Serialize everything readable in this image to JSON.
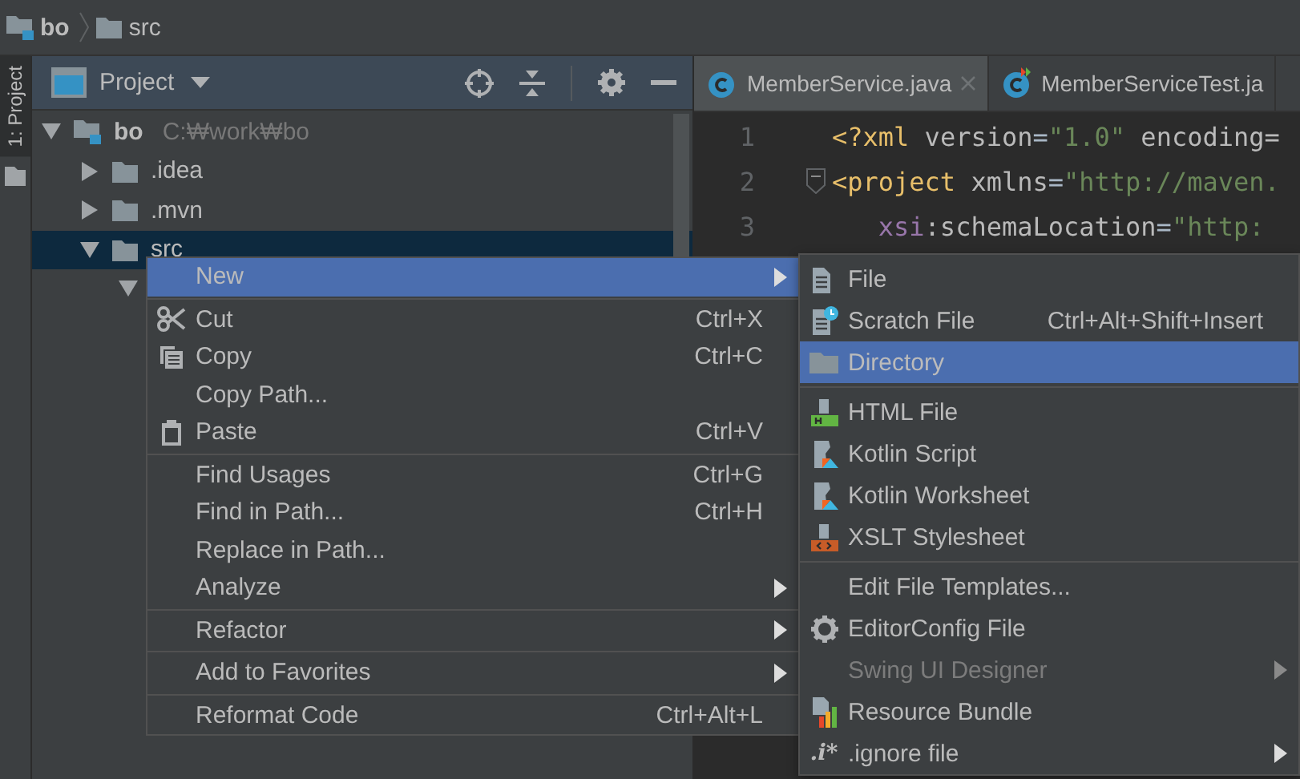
{
  "breadcrumb": [
    {
      "label": "bo",
      "kind": "module"
    },
    {
      "label": "src",
      "kind": "folder"
    }
  ],
  "tool_strip": {
    "tab_label": "1: Project"
  },
  "project_panel": {
    "title": "Project",
    "tree": [
      {
        "label": "bo",
        "path": "C:₩work₩bo",
        "kind": "module",
        "expanded": true,
        "selected": false,
        "children": [
          {
            "label": ".idea",
            "kind": "folder",
            "expanded": false,
            "selected": false
          },
          {
            "label": ".mvn",
            "kind": "folder",
            "expanded": false,
            "selected": false
          },
          {
            "label": "src",
            "kind": "folder",
            "expanded": true,
            "selected": true,
            "children": [
              {
                "expanded": true,
                "selected": false
              }
            ]
          }
        ]
      }
    ]
  },
  "editor": {
    "tabs": [
      {
        "label": "MemberService.java",
        "kind": "class",
        "selected": true
      },
      {
        "label": "MemberServiceTest.ja",
        "kind": "test-class",
        "selected": false
      }
    ],
    "lines": [
      {
        "number": "1",
        "fold": false,
        "tokens": [
          {
            "text": "<?xml",
            "kind": "tag"
          },
          {
            "text": " version",
            "kind": "attr"
          },
          {
            "text": "=",
            "kind": "plain"
          },
          {
            "text": "\"1.0\"",
            "kind": "value"
          },
          {
            "text": " encoding=",
            "kind": "attr"
          }
        ]
      },
      {
        "number": "2",
        "fold": true,
        "tokens": [
          {
            "text": "<project",
            "kind": "tag"
          },
          {
            "text": " xmlns",
            "kind": "attr"
          },
          {
            "text": "=",
            "kind": "plain"
          },
          {
            "text": "\"http://maven.",
            "kind": "value"
          }
        ]
      },
      {
        "number": "3",
        "fold": false,
        "tokens": [
          {
            "text": "   xsi",
            "kind": "ns"
          },
          {
            "text": ":schemaLocation",
            "kind": "attr"
          },
          {
            "text": "=",
            "kind": "plain"
          },
          {
            "text": "\"http:",
            "kind": "value"
          }
        ]
      }
    ]
  },
  "context_menu": {
    "groups": [
      [
        {
          "label": "New",
          "kind": "plain",
          "submenu": true,
          "selected": true
        }
      ],
      [
        {
          "label": "Cut",
          "shortcut": "Ctrl+X",
          "kind": "scissors",
          "submenu": false,
          "selected": false
        },
        {
          "label": "Copy",
          "shortcut": "Ctrl+C",
          "kind": "copy",
          "submenu": false,
          "selected": false
        },
        {
          "label": "Copy Path...",
          "kind": "plain",
          "submenu": false,
          "selected": false
        },
        {
          "label": "Paste",
          "shortcut": "Ctrl+V",
          "kind": "paste",
          "submenu": false,
          "selected": false
        }
      ],
      [
        {
          "label": "Find Usages",
          "shortcut": "Ctrl+G",
          "kind": "plain",
          "submenu": false,
          "selected": false
        },
        {
          "label": "Find in Path...",
          "shortcut": "Ctrl+H",
          "kind": "plain",
          "submenu": false,
          "selected": false
        },
        {
          "label": "Replace in Path...",
          "kind": "plain",
          "submenu": false,
          "selected": false
        },
        {
          "label": "Analyze",
          "kind": "plain",
          "submenu": true,
          "selected": false
        }
      ],
      [
        {
          "label": "Refactor",
          "kind": "plain",
          "submenu": true,
          "selected": false
        }
      ],
      [
        {
          "label": "Add to Favorites",
          "kind": "plain",
          "submenu": true,
          "selected": false
        }
      ],
      [
        {
          "label": "Reformat Code",
          "shortcut": "Ctrl+Alt+L",
          "kind": "plain",
          "submenu": false,
          "selected": false
        }
      ]
    ]
  },
  "submenu": {
    "groups": [
      [
        {
          "label": "File",
          "kind": "file",
          "submenu": false,
          "disabled": false,
          "selected": false
        },
        {
          "label": "Scratch File",
          "shortcut": "Ctrl+Alt+Shift+Insert",
          "kind": "scratch",
          "submenu": false,
          "disabled": false,
          "selected": false
        },
        {
          "label": "Directory",
          "kind": "folder",
          "submenu": false,
          "disabled": false,
          "selected": true
        }
      ],
      [
        {
          "label": "HTML File",
          "kind": "html",
          "submenu": false,
          "disabled": false,
          "selected": false
        },
        {
          "label": "Kotlin Script",
          "kind": "kotlin",
          "submenu": false,
          "disabled": false,
          "selected": false
        },
        {
          "label": "Kotlin Worksheet",
          "kind": "kotlin",
          "submenu": false,
          "disabled": false,
          "selected": false
        },
        {
          "label": "XSLT Stylesheet",
          "kind": "xslt",
          "submenu": false,
          "disabled": false,
          "selected": false
        }
      ],
      [
        {
          "label": "Edit File Templates...",
          "kind": "plain",
          "submenu": false,
          "disabled": false,
          "selected": false
        },
        {
          "label": "EditorConfig File",
          "kind": "gear",
          "submenu": false,
          "disabled": false,
          "selected": false
        },
        {
          "label": "Swing UI Designer",
          "kind": "plain",
          "submenu": true,
          "disabled": true,
          "selected": false
        },
        {
          "label": "Resource Bundle",
          "kind": "bundle",
          "submenu": false,
          "disabled": false,
          "selected": false
        },
        {
          "label": ".ignore file",
          "kind": "ignore",
          "badge": ".i*",
          "submenu": true,
          "disabled": false,
          "selected": false
        }
      ]
    ]
  }
}
